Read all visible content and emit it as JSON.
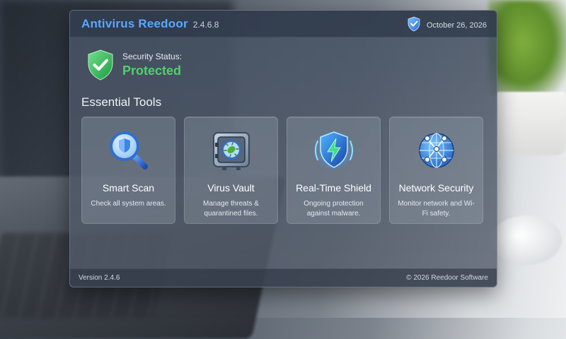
{
  "header": {
    "app_name": "Antivirus Reedoor",
    "version": "2.4.6.8",
    "date": "October 26, 2026",
    "shield_icon": "shield-check-icon"
  },
  "status": {
    "label": "Security Status:",
    "value": "Protected",
    "icon": "shield-check-icon",
    "color": "#4fd16a"
  },
  "section": {
    "title": "Essential Tools"
  },
  "tools": [
    {
      "title": "Smart Scan",
      "desc": "Check all system areas.",
      "icon": "magnifier-shield-icon"
    },
    {
      "title": "Virus Vault",
      "desc": "Manage threats & quarantined files.",
      "icon": "vault-virus-icon"
    },
    {
      "title": "Real-Time Shield",
      "desc": "Ongoing protection against malware.",
      "icon": "lightning-shield-icon"
    },
    {
      "title": "Network Security",
      "desc": "Monitor network and Wi-Fi safety.",
      "icon": "globe-network-icon"
    }
  ],
  "footer": {
    "version": "Version 2.4.6",
    "copyright": "© 2026 Reedoor Software"
  },
  "colors": {
    "accent": "#5aa8ff",
    "protected": "#4fd16a"
  }
}
